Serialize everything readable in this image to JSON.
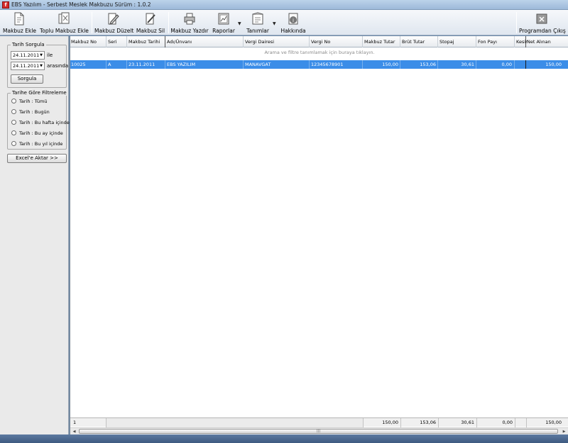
{
  "window": {
    "title": "EBS Yazılım - Serbest Meslek Makbuzu Sürüm : 1.0.2"
  },
  "toolbar": {
    "add": "Makbuz Ekle",
    "bulk_add": "Toplu Makbuz Ekle",
    "edit": "Makbuz Düzelt",
    "delete": "Makbuz Sil",
    "print": "Makbuz Yazdır",
    "reports": "Raporlar",
    "definitions": "Tanımlar",
    "about": "Hakkında",
    "exit": "Programdan Çıkış"
  },
  "left": {
    "date_query_title": "Tarih Sorgula",
    "date_from": "24.11.2011",
    "date_from_label": "ile",
    "date_to": "24.11.2011",
    "date_to_label": "arasında",
    "query_button": "Sorgula",
    "filter_title": "Tarihe Göre Filtreleme",
    "filters": [
      "Tarih : Tümü",
      "Tarih : Bugün",
      "Tarih : Bu hafta içinde",
      "Tarih : Bu ay içinde",
      "Tarih : Bu yıl içinde"
    ],
    "export_button": "Excel'e Aktar >>"
  },
  "grid": {
    "columns": [
      "Makbuz No",
      "Seri",
      "Makbuz Tarihi",
      "Adı/Ünvanı",
      "Vergi Dairesi",
      "Vergi No",
      "Makbuz Tutar",
      "Brüt Tutar",
      "Stopaj",
      "Fon Payı",
      "Kesir",
      "Net Alınan"
    ],
    "filter_hint": "Arama ve filtre tanımlamak için buraya tıklayın.",
    "rows": [
      [
        "10025",
        "A",
        "23.11.2011",
        "EBS YAZILIM",
        "MANAVGAT",
        "12345678901",
        "150,00",
        "153,06",
        "30,61",
        "0,00",
        "",
        "150,00"
      ]
    ],
    "footer": {
      "count": "1",
      "makbuz_tutar": "150,00",
      "brut_tutar": "153,06",
      "stopaj": "30,61",
      "fon_payi": "0,00",
      "net_alinan": "150,00"
    }
  },
  "colors": {
    "selection": "#3b8de8",
    "app_icon": "#d42a2a"
  }
}
